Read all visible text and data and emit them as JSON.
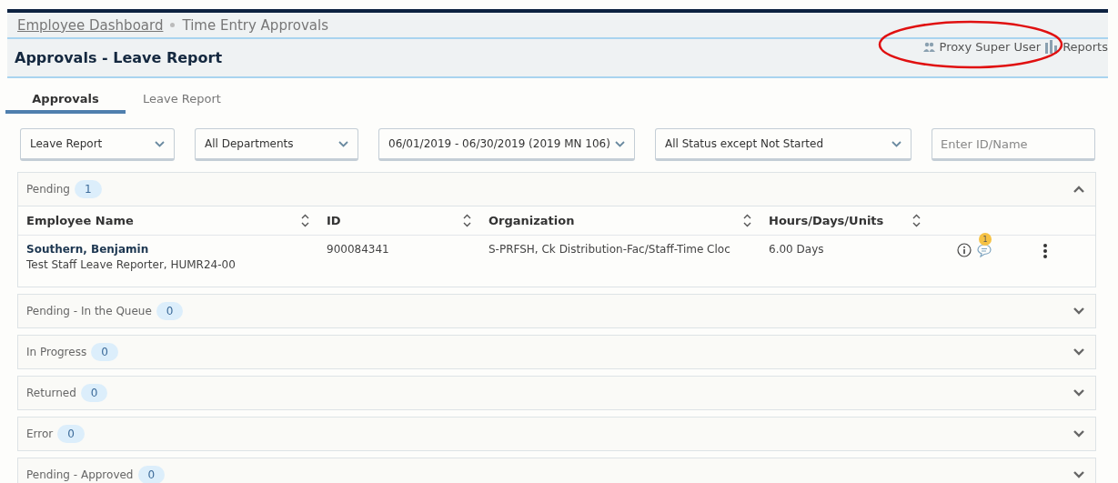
{
  "breadcrumb": [
    {
      "label": "Employee Dashboard",
      "link": true
    },
    {
      "label": "Time Entry Approvals",
      "link": false
    }
  ],
  "page_title": "Approvals - Leave Report",
  "header_links": [
    {
      "kind": "proxy",
      "label": "Proxy Super User"
    },
    {
      "kind": "reports",
      "label": "Reports"
    }
  ],
  "annotation": {
    "kind": "ellipse",
    "color": "#e01010"
  },
  "tabs": [
    {
      "label": "Approvals",
      "selected": true
    },
    {
      "label": "Leave Report",
      "selected": false
    }
  ],
  "filters": [
    {
      "kind": "select",
      "value": "Leave Report"
    },
    {
      "kind": "select",
      "value": "All Departments"
    },
    {
      "kind": "select",
      "value": "06/01/2019 - 06/30/2019 (2019 MN 106)"
    },
    {
      "kind": "select",
      "value": "All Status except Not Started"
    },
    {
      "kind": "input",
      "placeholder": "Enter ID/Name"
    }
  ],
  "sections": [
    {
      "label": "Pending",
      "count": "1",
      "expanded": true,
      "columns": [
        "Employee Name",
        "ID",
        "Organization",
        "Hours/Days/Units"
      ],
      "rows": [
        {
          "name": "Southern, Benjamin",
          "subtitle": "Test Staff Leave Reporter, HUMR24-00",
          "id": "900084341",
          "organization": "S-PRFSH, Ck Distribution-Fac/Staff-Time Cloc",
          "amount": "6.00 Days",
          "comment_count": "1"
        }
      ]
    },
    {
      "label": "Pending - In the Queue",
      "count": "0",
      "expanded": false
    },
    {
      "label": "In Progress",
      "count": "0",
      "expanded": false
    },
    {
      "label": "Returned",
      "count": "0",
      "expanded": false
    },
    {
      "label": "Error",
      "count": "0",
      "expanded": false
    },
    {
      "label": "Pending - Approved",
      "count": "0",
      "expanded": false
    }
  ]
}
